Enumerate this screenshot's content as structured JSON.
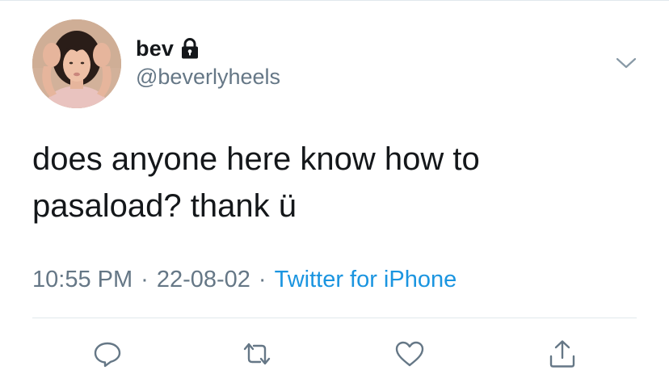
{
  "tweet": {
    "display_name": "bev",
    "handle": "@beverlyheels",
    "text": "does anyone here know how to\npasaload? thank ü",
    "time": "10:55 PM",
    "date": "22-08-02",
    "separator": "·",
    "source": "Twitter for iPhone",
    "protected": true
  },
  "icons": {
    "lock": "lock-icon",
    "caret": "chevron-down-icon",
    "reply": "reply-icon",
    "retweet": "retweet-icon",
    "like": "heart-icon",
    "share": "share-icon"
  },
  "colors": {
    "text": "#14171a",
    "secondary": "#657786",
    "link": "#1b95e0",
    "divider": "#e1e8ed"
  }
}
